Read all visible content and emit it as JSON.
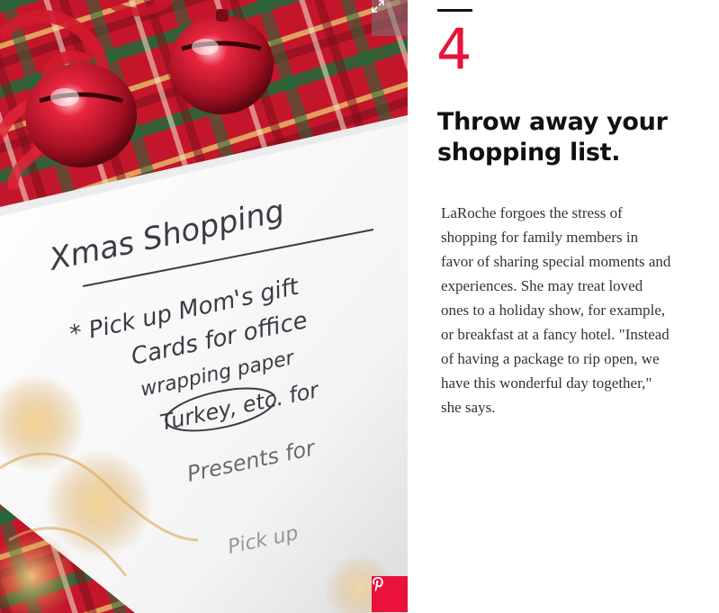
{
  "slide": {
    "number": "4",
    "title": "Throw away your shopping list.",
    "body": "LaRoche forgoes the stress of shopping for family members in favor of sharing special moments and experiences. She may treat loved ones to a holiday show, for example, or breakfast at a fancy hotel. \"Instead of having a package to rip open, we have this wonderful day together,\" she says."
  },
  "photo": {
    "handwritten_note": {
      "heading": "Xmas Shopping",
      "lines": [
        "* Pick up Mom's gift",
        "Cards for office",
        "wrapping paper",
        "Turkey, etc. for",
        "Presents for",
        "Pick up"
      ]
    }
  },
  "icons": {
    "expand": "expand-icon",
    "pinterest": "pinterest-icon"
  },
  "colors": {
    "accent": "#e8123a",
    "title": "#111111",
    "body": "#333333"
  }
}
